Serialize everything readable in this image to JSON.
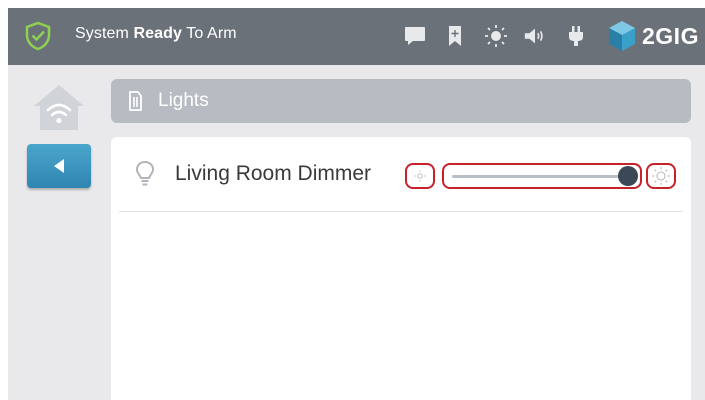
{
  "header": {
    "status_prefix": "System",
    "status_bold": "Ready",
    "status_suffix": "To Arm",
    "brand": "2GIG"
  },
  "icons": {
    "status": "shield-check-icon",
    "messages": "message-icon",
    "bookmark": "bookmark-icon",
    "brightness": "brightness-icon",
    "volume": "volume-icon",
    "power": "power-plug-icon",
    "home": "home-wifi-icon",
    "back": "back-arrow-icon",
    "section": "lights-icon",
    "bulb": "bulb-icon",
    "dim_down": "sun-small-icon",
    "dim_up": "sun-large-icon"
  },
  "colors": {
    "header_bg": "#6b7178",
    "shield_green": "#8ed14f",
    "accent_blue": "#3592bd",
    "highlight_red": "#c7212b"
  },
  "section": {
    "title": "Lights"
  },
  "devices": [
    {
      "label": "Living Room Dimmer",
      "level": 1.0
    }
  ]
}
